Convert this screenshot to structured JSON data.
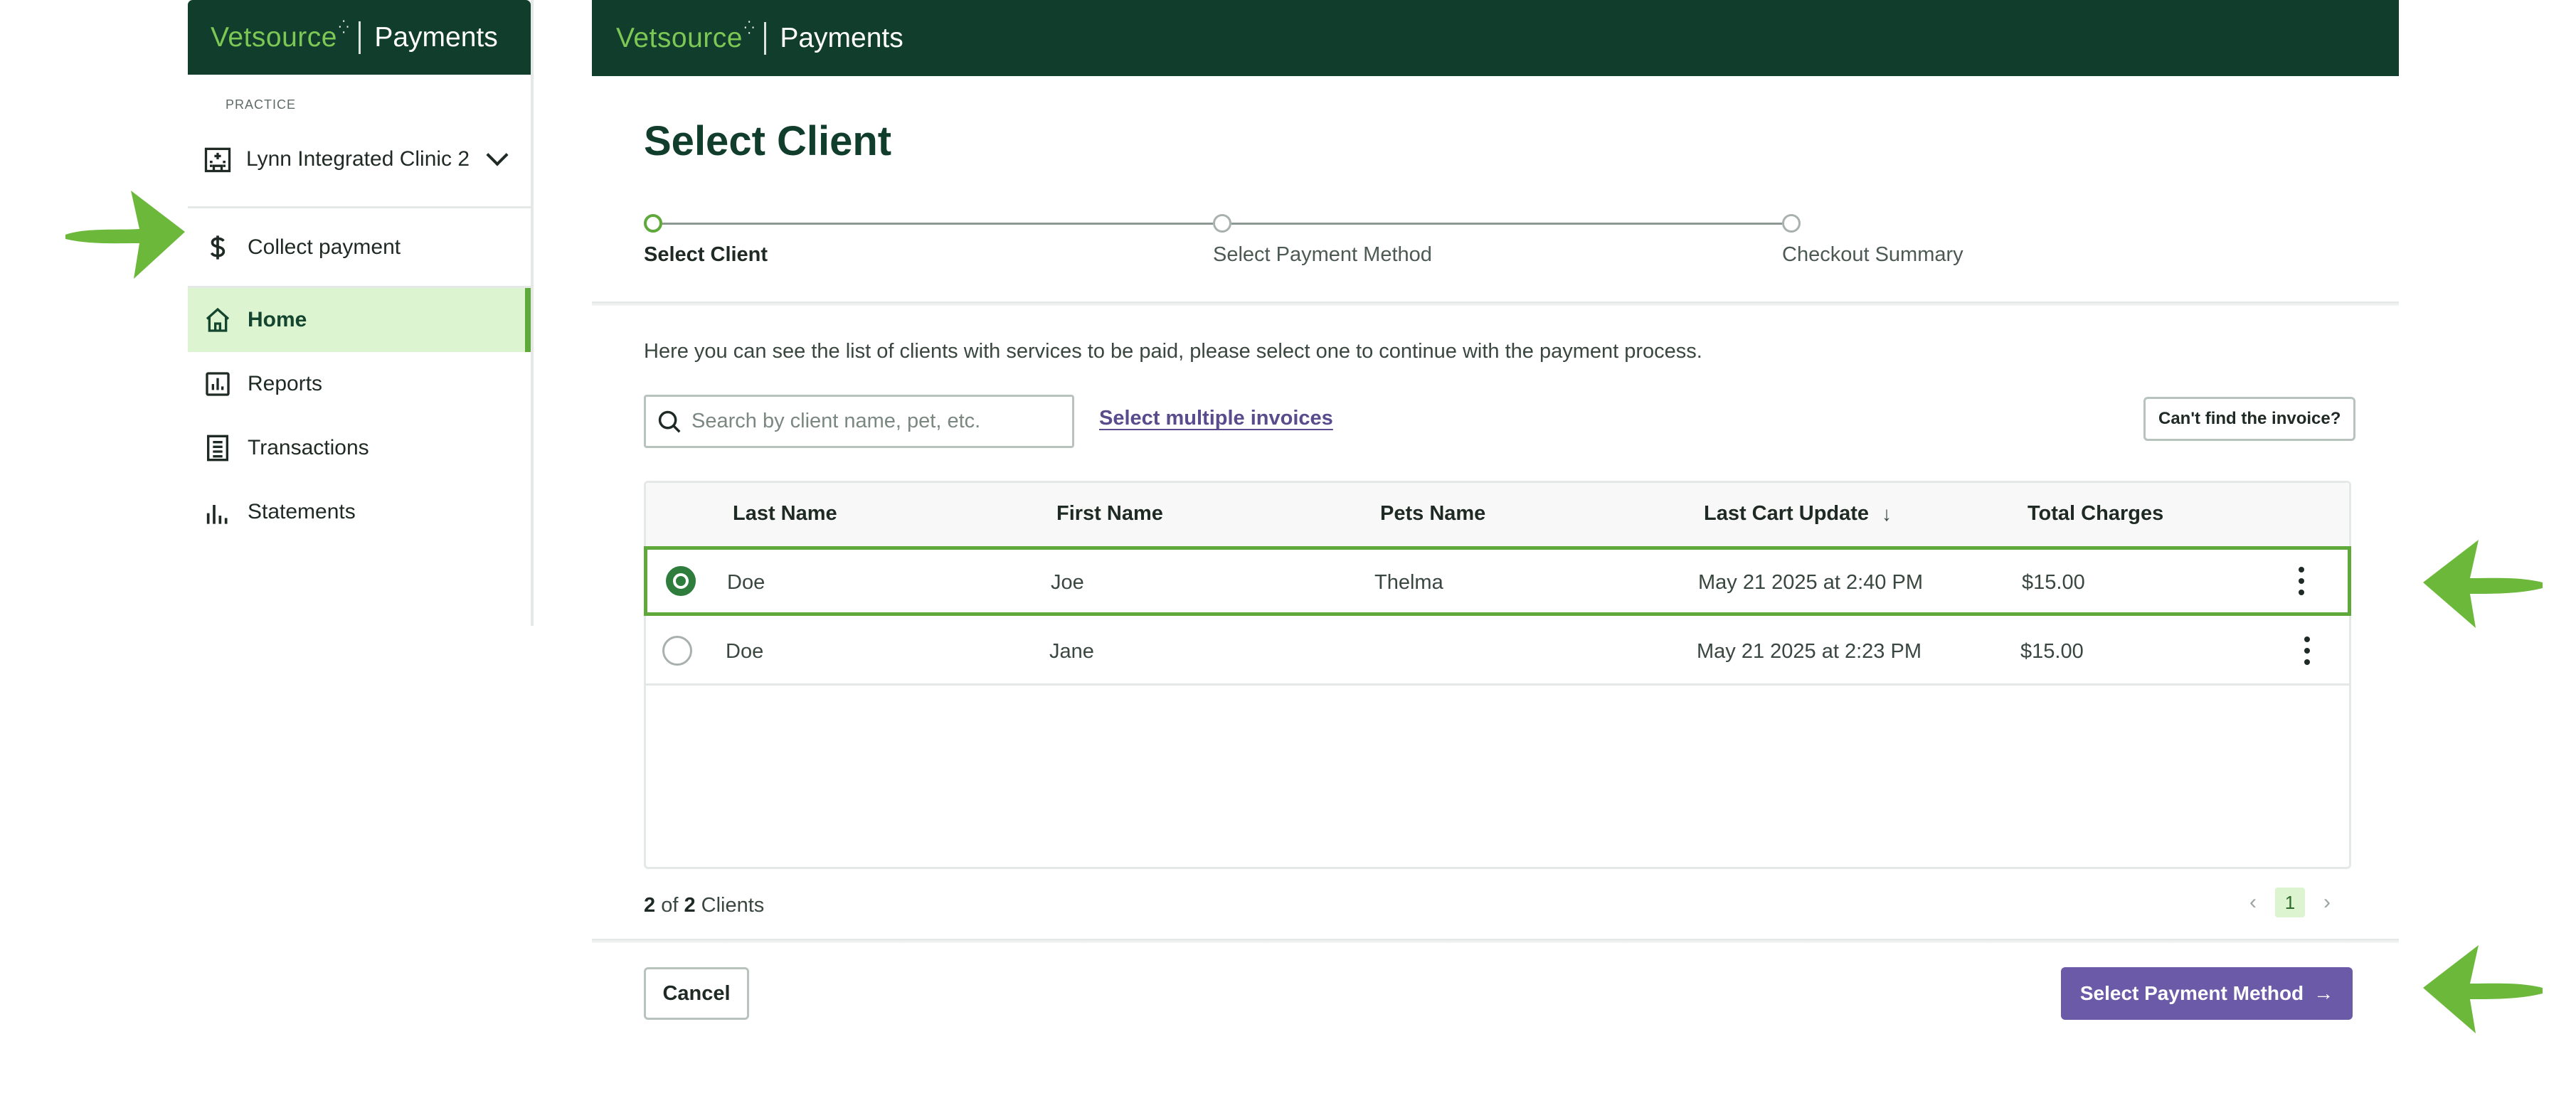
{
  "brand": {
    "name": "Vetsource",
    "product": "Payments"
  },
  "sidebar": {
    "practice_caption": "PRACTICE",
    "practice_name": "Lynn Integrated Clinic 2",
    "items": [
      {
        "label": "Collect payment",
        "icon": "dollar-icon"
      },
      {
        "label": "Home",
        "icon": "home-icon",
        "active": true
      },
      {
        "label": "Reports",
        "icon": "bar-chart-icon"
      },
      {
        "label": "Transactions",
        "icon": "receipt-icon"
      },
      {
        "label": "Statements",
        "icon": "column-chart-icon"
      }
    ]
  },
  "page": {
    "title": "Select Client",
    "steps": [
      "Select Client",
      "Select Payment Method",
      "Checkout Summary"
    ],
    "current_step": 0,
    "intro": "Here you can see the list of clients with services to be paid, please select one to continue with the payment process.",
    "search_placeholder": "Search by client name, pet, etc.",
    "multi_link": "Select multiple invoices",
    "cant_find": "Can't find the invoice?"
  },
  "table": {
    "columns": [
      "Last Name",
      "First Name",
      "Pets Name",
      "Last Cart Update",
      "Total Charges"
    ],
    "sort_arrow": "↓",
    "rows": [
      {
        "last": "Doe",
        "first": "Joe",
        "pet": "Thelma",
        "updated": "May 21 2025 at 2:40 PM",
        "total": "$15.00",
        "selected": true
      },
      {
        "last": "Doe",
        "first": "Jane",
        "pet": "",
        "updated": "May 21 2025 at 2:23 PM",
        "total": "$15.00",
        "selected": false
      }
    ]
  },
  "footer": {
    "count_shown": "2",
    "count_of": "of",
    "count_total": "2",
    "count_unit": "Clients",
    "page": "1",
    "cancel": "Cancel",
    "next": "Select Payment Method",
    "next_arrow": "→"
  },
  "colors": {
    "brand_dark": "#103d2c",
    "brand_green": "#7dc855",
    "accent_green": "#5fa83a",
    "primary_purple": "#6a5aa8",
    "annotation_arrow": "#6bb83a"
  }
}
